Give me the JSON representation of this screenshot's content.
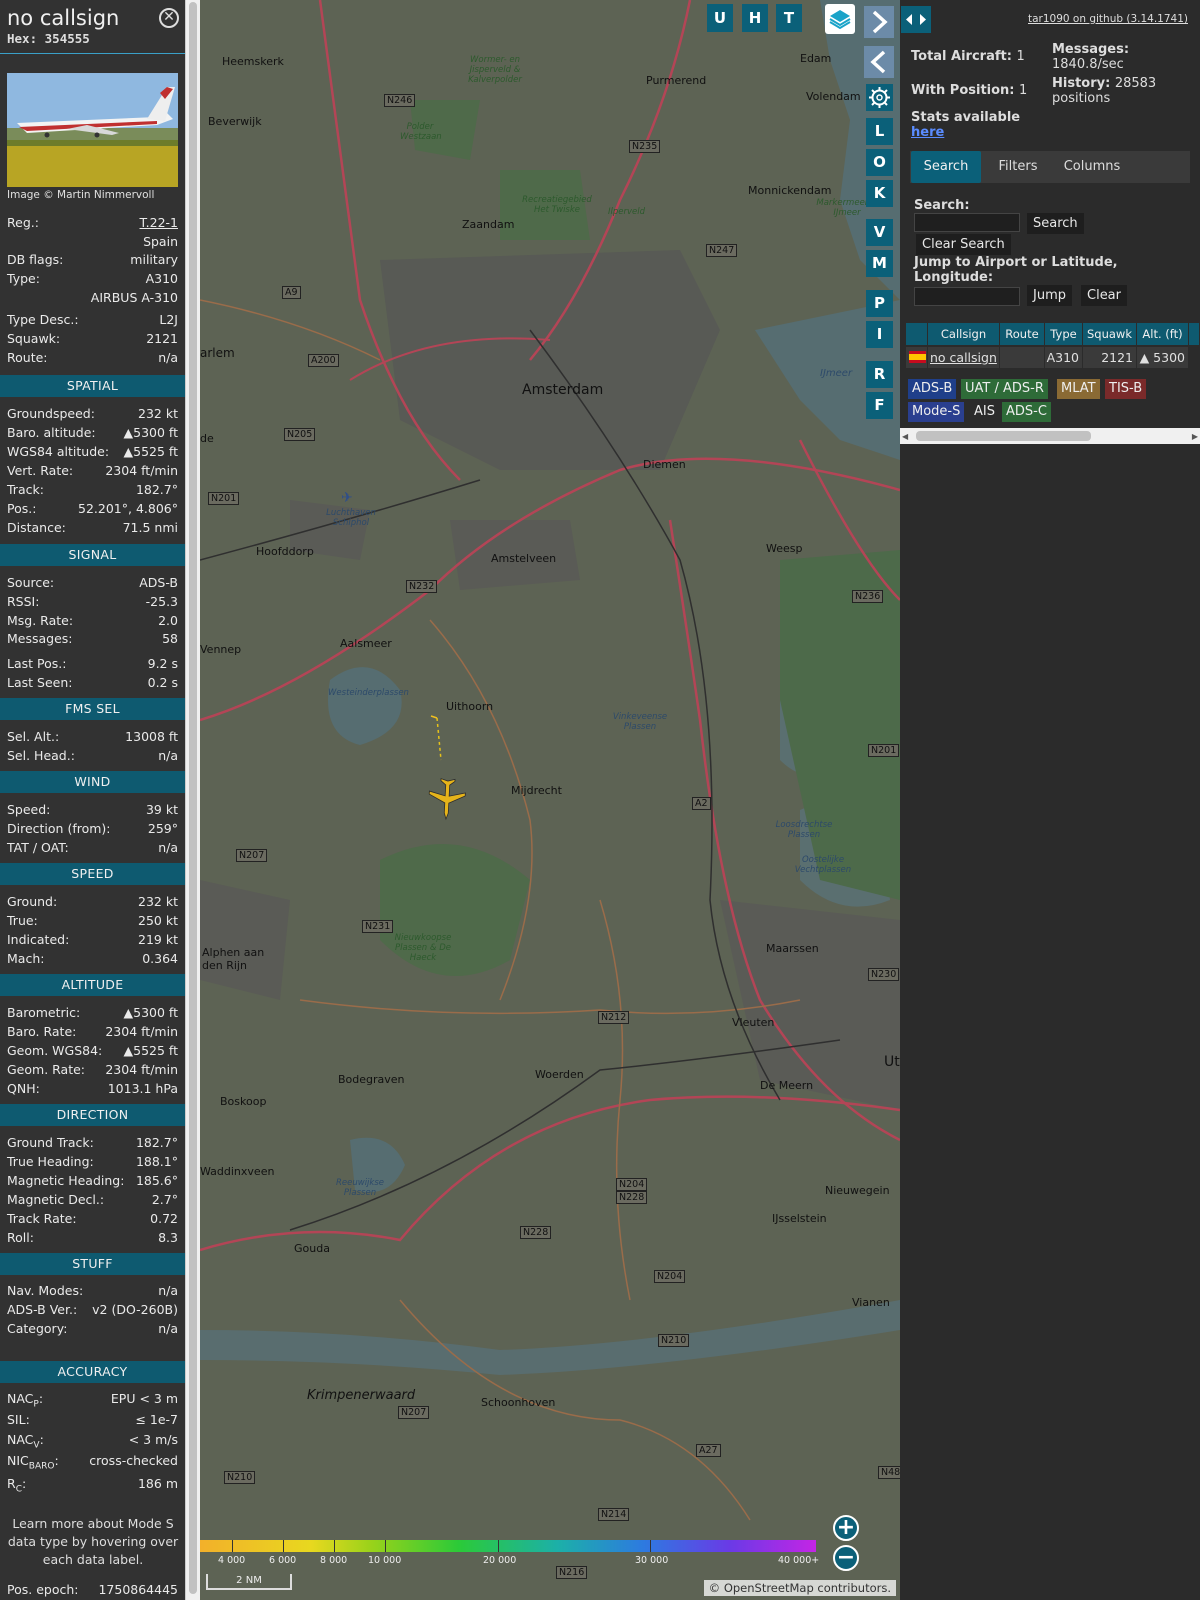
{
  "info": {
    "callsign": "no callsign",
    "hex_label": "Hex:",
    "hex": "354555",
    "photo_credit": "Image © Martin Nimmervoll",
    "reg_label": "Reg.:",
    "reg": "T.22-1",
    "country": "Spain",
    "db_flags_label": "DB flags:",
    "db_flags": "military",
    "type_label": "Type:",
    "type": "A310",
    "type_full": "AIRBUS A-310",
    "type_desc_label": "Type Desc.:",
    "type_desc": "L2J",
    "squawk_label": "Squawk:",
    "squawk": "2121",
    "route_label": "Route:",
    "route": "n/a",
    "spatial": {
      "header": "SPATIAL",
      "groundspeed_label": "Groundspeed:",
      "groundspeed": "232 kt",
      "baro_alt_label": "Baro. altitude:",
      "baro_alt": "▲5300 ft",
      "wgs84_label": "WGS84 altitude:",
      "wgs84": "▲5525 ft",
      "vert_rate_label": "Vert. Rate:",
      "vert_rate": "2304 ft/min",
      "track_label": "Track:",
      "track": "182.7°",
      "pos_label": "Pos.:",
      "pos": "52.201°, 4.806°",
      "distance_label": "Distance:",
      "distance": "71.5 nmi"
    },
    "signal": {
      "header": "SIGNAL",
      "source_label": "Source:",
      "source": "ADS-B",
      "rssi_label": "RSSI:",
      "rssi": "-25.3",
      "msg_rate_label": "Msg. Rate:",
      "msg_rate": "2.0",
      "messages_label": "Messages:",
      "messages": "58",
      "last_pos_label": "Last Pos.:",
      "last_pos": "9.2 s",
      "last_seen_label": "Last Seen:",
      "last_seen": "0.2 s"
    },
    "fms": {
      "header": "FMS SEL",
      "sel_alt_label": "Sel. Alt.:",
      "sel_alt": "13008 ft",
      "sel_head_label": "Sel. Head.:",
      "sel_head": "n/a"
    },
    "wind": {
      "header": "WIND",
      "speed_label": "Speed:",
      "speed": "39 kt",
      "dir_label": "Direction (from):",
      "dir": "259°",
      "tat_label": "TAT / OAT:",
      "tat": "n/a"
    },
    "speed": {
      "header": "SPEED",
      "ground_label": "Ground:",
      "ground": "232 kt",
      "true_label": "True:",
      "true": "250 kt",
      "indicated_label": "Indicated:",
      "indicated": "219 kt",
      "mach_label": "Mach:",
      "mach": "0.364"
    },
    "altitude": {
      "header": "ALTITUDE",
      "baro_label": "Barometric:",
      "baro": "▲5300 ft",
      "baro_rate_label": "Baro. Rate:",
      "baro_rate": "2304 ft/min",
      "geom_label": "Geom. WGS84:",
      "geom": "▲5525 ft",
      "geom_rate_label": "Geom. Rate:",
      "geom_rate": "2304 ft/min",
      "qnh_label": "QNH:",
      "qnh": "1013.1 hPa"
    },
    "direction": {
      "header": "DIRECTION",
      "ground_track_label": "Ground Track:",
      "ground_track": "182.7°",
      "true_heading_label": "True Heading:",
      "true_heading": "188.1°",
      "mag_heading_label": "Magnetic Heading:",
      "mag_heading": "185.6°",
      "mag_decl_label": "Magnetic Decl.:",
      "mag_decl": "2.7°",
      "track_rate_label": "Track Rate:",
      "track_rate": "0.72",
      "roll_label": "Roll:",
      "roll": "8.3"
    },
    "stuff": {
      "header": "STUFF",
      "nav_modes_label": "Nav. Modes:",
      "nav_modes": "n/a",
      "adsb_ver_label": "ADS-B Ver.:",
      "adsb_ver": "v2 (DO-260B)",
      "category_label": "Category:",
      "category": "n/a"
    },
    "accuracy": {
      "header": "ACCURACY",
      "nacp_label": "NAC",
      "nacp_sub": "P",
      "nacp": "EPU < 3 m",
      "sil_label": "SIL:",
      "sil": "≤ 1e-7",
      "nacv_label": "NAC",
      "nacv_sub": "V",
      "nacv": "< 3 m/s",
      "nicbaro_label": "NIC",
      "nicbaro_sub": "BARO",
      "nicbaro": "cross-checked",
      "rc_label": "R",
      "rc_sub": "C",
      "rc": "186 m"
    },
    "learn_more": "Learn more about Mode S data type by hovering over each data label.",
    "pos_epoch_label": "Pos. epoch:",
    "pos_epoch": "1750864445"
  },
  "map": {
    "top_buttons": [
      "U",
      "H",
      "T"
    ],
    "side_buttons": [
      "L",
      "O",
      "K",
      "V",
      "M",
      "P",
      "I",
      "R",
      "F"
    ],
    "attribution_prefix": "© ",
    "attribution_link": "OpenStreetMap",
    "attribution_suffix": " contributors.",
    "scale": "2 NM",
    "altitude_scale": [
      "4 000",
      "6 000",
      "8 000",
      "10 000",
      "20 000",
      "30 000",
      "40 000+"
    ],
    "places": [
      "Heemskerk",
      "Beverwijk",
      "Wormer- en Jisperveld & Kalverpolder",
      "Polder Westzaan",
      "Purmerend",
      "Edam",
      "Volendam",
      "Zaandam",
      "Recreatiegebied Het Twiske",
      "Ilperveld",
      "Monnickendam",
      "Markermeer & IJmeer",
      "Amsterdam",
      "Diemen",
      "IJmeer",
      "Hoofddorp",
      "Luchthaven Schiphol",
      "Amstelveen",
      "Weesp",
      "Aalsmeer",
      "Westeinderplassen",
      "Uithoorn",
      "Vinkeveense Plassen",
      "Mijdrecht",
      "Loosdrechtse Plassen",
      "Oostelijke Vechtplassen",
      "Nieuwkoopse Plassen & De Haeck",
      "Alphen aan den Rijn",
      "Maarssen",
      "Vleuten",
      "Bodegraven",
      "Woerden",
      "De Meern",
      "Boskoop",
      "Waddinxveen",
      "Reeuwijkse Plassen",
      "Nieuwegein",
      "IJsselstein",
      "Gouda",
      "Vianen",
      "Krimpenerwaard",
      "Schoonhoven",
      "arlem",
      "Vennep",
      "Ut",
      "de"
    ],
    "roads": [
      "N246",
      "N235",
      "N247",
      "A9",
      "A200",
      "N205",
      "N201",
      "N232",
      "A2",
      "N207",
      "N231",
      "N212",
      "N236",
      "N201",
      "N230",
      "N204",
      "N228",
      "N204",
      "N210",
      "N228",
      "A27",
      "N214",
      "N216",
      "N210",
      "N207",
      "N48"
    ]
  },
  "right": {
    "github": "tar1090 on github (3.14.1741)",
    "total_aircraft_label": "Total Aircraft:",
    "total_aircraft": "1",
    "with_position_label": "With Position:",
    "with_position": "1",
    "messages_label": "Messages:",
    "messages": "1840.8/sec",
    "history_label": "History:",
    "history": "28583 positions",
    "stats_label": "Stats available",
    "stats_link": "here",
    "tabs": [
      "Search",
      "Filters",
      "Columns"
    ],
    "search_label": "Search:",
    "search_button": "Search",
    "clear_search_button": "Clear Search",
    "jump_label": "Jump to Airport or Latitude, Longitude:",
    "jump_button": "Jump",
    "clear_button": "Clear",
    "table_headers": [
      "Callsign",
      "Route",
      "Type",
      "Squawk",
      "Alt. (ft)"
    ],
    "row": {
      "callsign": "no callsign",
      "route": "",
      "type": "A310",
      "squawk": "2121",
      "alt": "▲ 5300"
    },
    "sources": [
      "ADS-B",
      "UAT / ADS-R",
      "MLAT",
      "TIS-B",
      "Mode-S",
      "AIS",
      "ADS-C"
    ],
    "colors": {
      "adsb": "#1f3f8a",
      "uat": "#2e6b38",
      "mlat": "#8a6a34",
      "tisb": "#7a2a2a",
      "modes": "#2a3f8f",
      "ais": "#2b2b2b",
      "adsc": "#2e6b38"
    }
  }
}
